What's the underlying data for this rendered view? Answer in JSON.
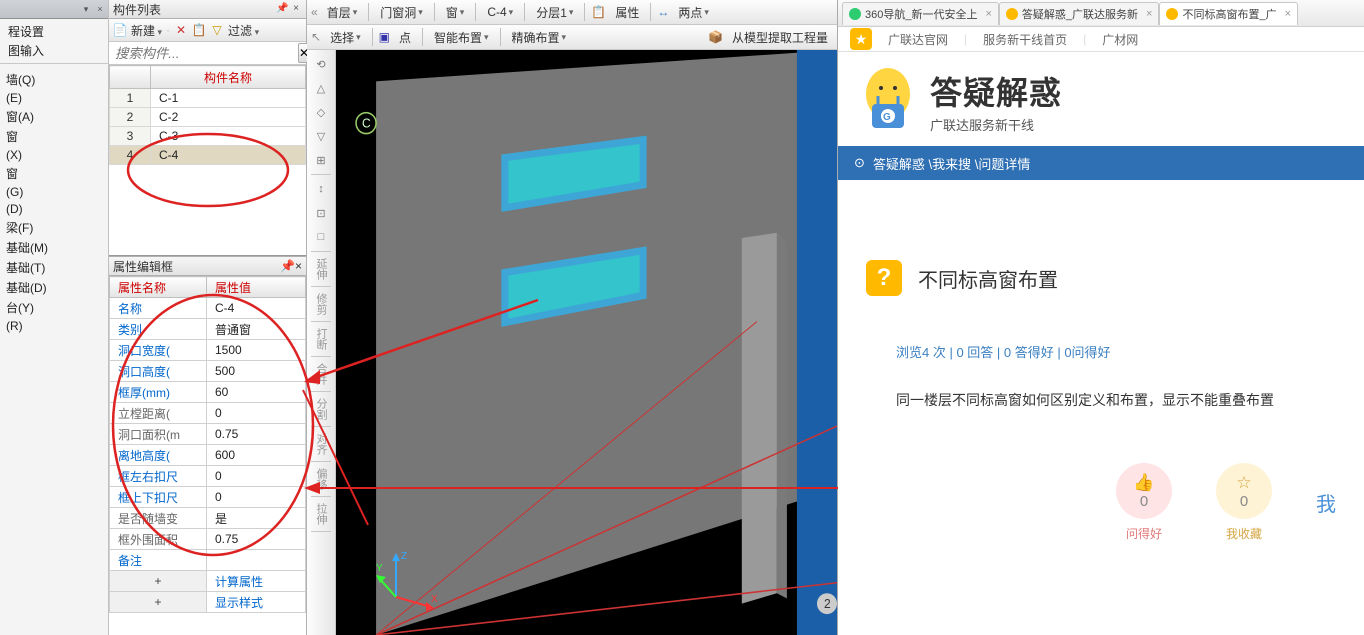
{
  "left": {
    "cfg1": "程设置",
    "cfg2": "图输入",
    "items": [
      "",
      "墙(Q)",
      "(E)",
      "",
      "窗(A)",
      "窗",
      "(X)",
      "窗",
      "(G)",
      "(D)",
      "",
      "梁(F)",
      "基础(M)",
      "基础(T)",
      "基础(D)",
      "台(Y)",
      "(R)"
    ]
  },
  "component_panel": {
    "title": "构件列表",
    "new_label": "新建",
    "filter_label": "过滤",
    "search_placeholder": "搜索构件...",
    "header": "构件名称",
    "rows": [
      {
        "n": "1",
        "name": "C-1"
      },
      {
        "n": "2",
        "name": "C-2"
      },
      {
        "n": "3",
        "name": "C-3"
      },
      {
        "n": "4",
        "name": "C-4"
      }
    ]
  },
  "prop_panel": {
    "title": "属性编辑框",
    "h1": "属性名称",
    "h2": "属性值",
    "rows": [
      {
        "k": "名称",
        "v": "C-4",
        "blue": true
      },
      {
        "k": "类别",
        "v": "普通窗",
        "blue": true
      },
      {
        "k": "洞口宽度(",
        "v": "1500",
        "blue": true
      },
      {
        "k": "洞口高度(",
        "v": "500",
        "blue": true
      },
      {
        "k": "框厚(mm)",
        "v": "60",
        "blue": true
      },
      {
        "k": "立樘距离(",
        "v": "0",
        "blue": false
      },
      {
        "k": "洞口面积(m",
        "v": "0.75",
        "blue": false
      },
      {
        "k": "离地高度(",
        "v": "600",
        "blue": true
      },
      {
        "k": "框左右扣尺",
        "v": "0",
        "blue": true
      },
      {
        "k": "框上下扣尺",
        "v": "0",
        "blue": true
      },
      {
        "k": "是否随墙变",
        "v": "是",
        "blue": false
      },
      {
        "k": "框外围面积",
        "v": "0.75",
        "blue": false
      },
      {
        "k": "备注",
        "v": "",
        "blue": true
      }
    ],
    "exp1": "计算属性",
    "exp2": "显示样式"
  },
  "viewport": {
    "top1": {
      "floor": "首层",
      "group": "门窗洞",
      "type": "窗",
      "item": "C-4",
      "layer": "分层1",
      "prop_btn": "属性",
      "points_btn": "两点"
    },
    "top2": {
      "select": "选择",
      "dot": "点",
      "smart": "智能布置",
      "precise": "精确布置",
      "extract": "从模型提取工程量"
    },
    "vlabels": [
      "延伸",
      "修剪",
      "打断",
      "合并",
      "分割",
      "对齐",
      "偏移",
      "拉伸"
    ]
  },
  "browser": {
    "tabs": [
      {
        "label": "360导航_新一代安全上",
        "active": false,
        "icon": "#2ecc71"
      },
      {
        "label": "答疑解惑_广联达服务新",
        "active": false,
        "icon": "#ffba00"
      },
      {
        "label": "不同标高窗布置_广",
        "active": true,
        "icon": "#ffba00"
      }
    ],
    "fav": [
      "广联达官网",
      "服务新干线首页",
      "广材网"
    ],
    "brand_t1": "答疑解惑",
    "brand_t2": "广联达服务新干线",
    "crumb": "答疑解惑 \\我来搜 \\问题详情",
    "q_title": "不同标高窗布置",
    "meta": "浏览4 次 | 0 回答 | 0 答得好 | 0问得好",
    "body": "同一楼层不同标高窗如何区别定义和布置，显示不能重叠布置",
    "act1": {
      "n": "0",
      "lbl": "问得好"
    },
    "act2": {
      "n": "0",
      "lbl": "我收藏"
    },
    "more": "我"
  }
}
